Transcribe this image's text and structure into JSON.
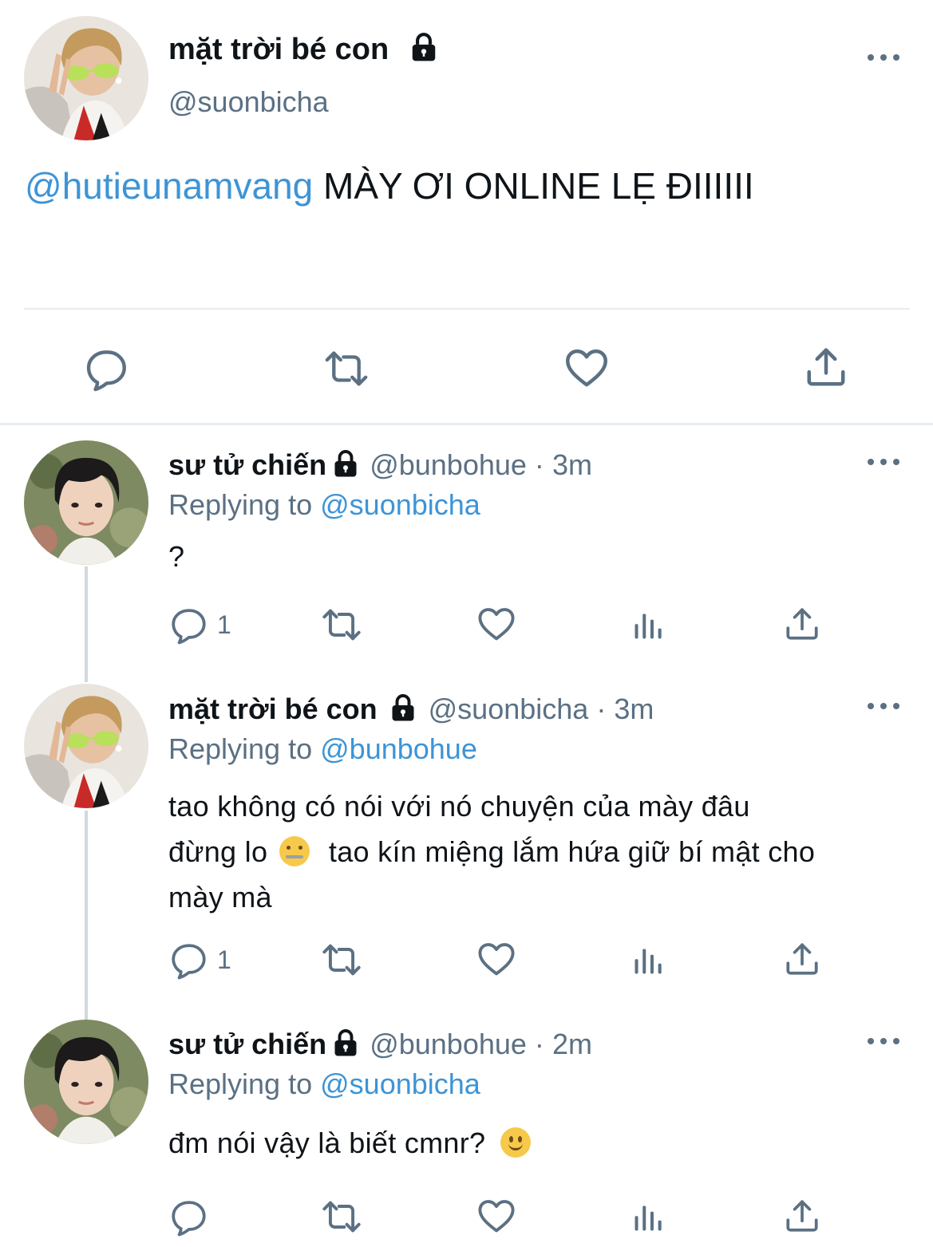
{
  "main_tweet": {
    "display_name": "mặt trời bé con",
    "handle": "@suonbicha",
    "mention": "@hutieunamvang",
    "text": "MÀY ƠI ONLINE LẸ ĐIIIIII",
    "icons": [
      "lock-icon",
      "more-icon",
      "reply-icon",
      "retweet-icon",
      "like-icon",
      "share-icon"
    ]
  },
  "replies": [
    {
      "display_name": "sư tử chiến",
      "handle": "@bunbohue",
      "separator": "·",
      "time": "3m",
      "replying_label": "Replying to",
      "replying_to": "@suonbicha",
      "text": "?",
      "reply_count": "1"
    },
    {
      "display_name": "mặt trời bé con",
      "handle": "@suonbicha",
      "separator": "·",
      "time": "3m",
      "replying_label": "Replying to",
      "replying_to": "@bunbohue",
      "text_line1": "tao không có nói với nó chuyện của mày đâu",
      "text_line2a": "đừng lo",
      "text_line2b": "tao kín miệng lắm hứa giữ bí mật cho",
      "text_line3": "mày mà",
      "emoji": "zipper-mouth-face",
      "reply_count": "1"
    },
    {
      "display_name": "sư tử chiến",
      "handle": "@bunbohue",
      "separator": "·",
      "time": "2m",
      "replying_label": "Replying to",
      "replying_to": "@suonbicha",
      "text": "đm nói vậy là biết cmnr?",
      "emoji": "slightly-smiling-face",
      "reply_count": ""
    }
  ],
  "colors": {
    "link": "#3d94d6",
    "secondary": "#5b7083",
    "text": "#0f1419",
    "divider": "#e6ecf0"
  }
}
